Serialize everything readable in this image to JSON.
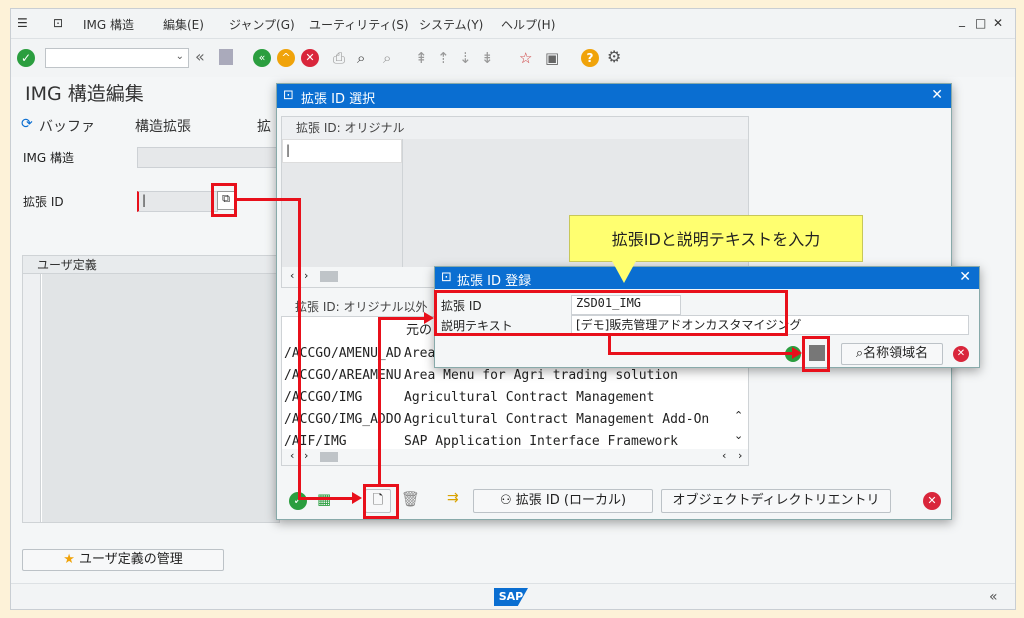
{
  "menu": {
    "img_structure": "IMG 構造",
    "edit": "編集(E)",
    "jump": "ジャンプ(G)",
    "utility": "ユーティリティ(S)",
    "system": "システム(Y)",
    "help": "ヘルプ(H)"
  },
  "window_controls": {
    "minimize": "_",
    "maximize": "□",
    "close": "✕"
  },
  "page_title": "IMG 構造編集",
  "app_toolbar": {
    "buffer": "バッファ",
    "structure_extension": "構造拡張",
    "ext_trunc": "拡"
  },
  "form": {
    "img_structure_label": "IMG 構造",
    "ext_id_label": "拡張 ID"
  },
  "user_defined": {
    "header": "ユーザ定義",
    "manage_button": "ユーザ定義の管理"
  },
  "dialog_select": {
    "title": "拡張 ID 選択",
    "section_original": "拡張 ID: オリジナル",
    "section_other": "拡張 ID: オリジナル以外",
    "col_original": "元の",
    "rows": [
      {
        "id": "/ACCGO/AMENU_AD",
        "desc": "Area"
      },
      {
        "id": "/ACCGO/AREAMENU",
        "desc": "Area Menu for Agri trading solution"
      },
      {
        "id": "/ACCGO/IMG",
        "desc": "Agricultural Contract Management"
      },
      {
        "id": "/ACCGO/IMG_ADDO",
        "desc": "Agricultural Contract Management Add-On"
      },
      {
        "id": "/AIF/IMG",
        "desc": "SAP Application Interface Framework"
      }
    ],
    "btn_local": "拡張 ID (ローカル)",
    "btn_object_dir": "オブジェクトディレクトリエントリ"
  },
  "dialog_register": {
    "title": "拡張 ID 登録",
    "ext_id_label": "拡張 ID",
    "ext_id_value": "ZSD01_IMG",
    "desc_label": "説明テキスト",
    "desc_value": "[デモ]販売管理アドオンカスタマイジング",
    "btn_namespace": "名称領域名"
  },
  "callout": "拡張IDと説明テキストを入力",
  "sap_logo": "SAP",
  "colors": {
    "accent": "#0a6ed1",
    "highlight": "#e8101b",
    "callout": "#ffff70"
  }
}
